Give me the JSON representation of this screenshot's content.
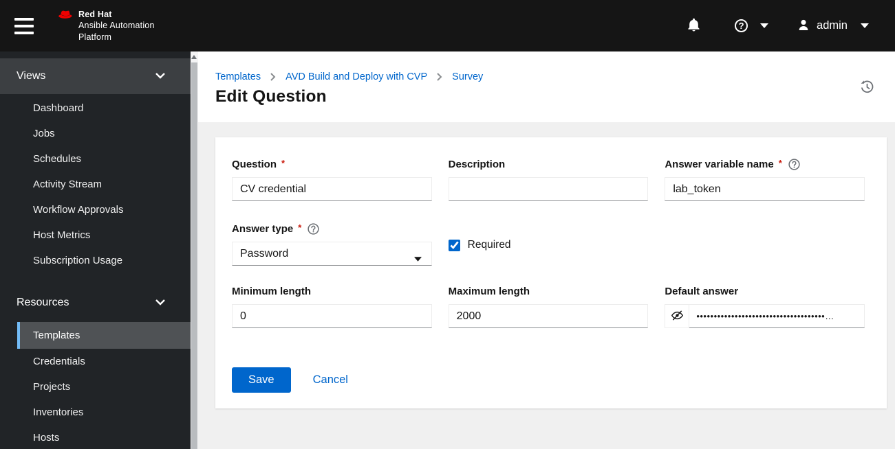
{
  "header": {
    "brand": {
      "line1": "Red Hat",
      "line2": "Ansible Automation",
      "line3": "Platform"
    },
    "user_label": "admin"
  },
  "icons": {
    "help_glyph": "?"
  },
  "sidebar": {
    "groups": [
      {
        "label": "Views",
        "items": [
          "Dashboard",
          "Jobs",
          "Schedules",
          "Activity Stream",
          "Workflow Approvals",
          "Host Metrics",
          "Subscription Usage"
        ]
      },
      {
        "label": "Resources",
        "items": [
          "Templates",
          "Credentials",
          "Projects",
          "Inventories",
          "Hosts"
        ],
        "selected_item": "Templates"
      }
    ]
  },
  "breadcrumb": {
    "items": [
      "Templates",
      "AVD Build and Deploy with CVP",
      "Survey"
    ]
  },
  "page": {
    "title": "Edit Question"
  },
  "form": {
    "required_indicator": "*",
    "question": {
      "label": "Question",
      "value": "CV credential"
    },
    "description": {
      "label": "Description",
      "value": ""
    },
    "answer_variable_name": {
      "label": "Answer variable name",
      "value": "lab_token"
    },
    "answer_type": {
      "label": "Answer type",
      "value": "Password"
    },
    "required_checkbox": {
      "label": "Required",
      "checked": "checked"
    },
    "minimum_length": {
      "label": "Minimum length",
      "value": "0"
    },
    "maximum_length": {
      "label": "Maximum length",
      "value": "2000"
    },
    "default_answer": {
      "label": "Default answer",
      "value": "•••••••••••••••••••••••••••••••••••••…"
    },
    "save_label": "Save",
    "cancel_label": "Cancel"
  },
  "colors": {
    "accent": "#0066cc",
    "masthead_bg": "#151515",
    "sidebar_bg": "#212427",
    "sidebar_group_expanded_bg": "#3c3f42",
    "sidebar_selected_bg": "#4f5255",
    "sidebar_selected_border": "#73bcf7",
    "page_bg": "#f0f0f0",
    "required_asterisk": "#c9190b",
    "brand_red": "#ee0000"
  }
}
